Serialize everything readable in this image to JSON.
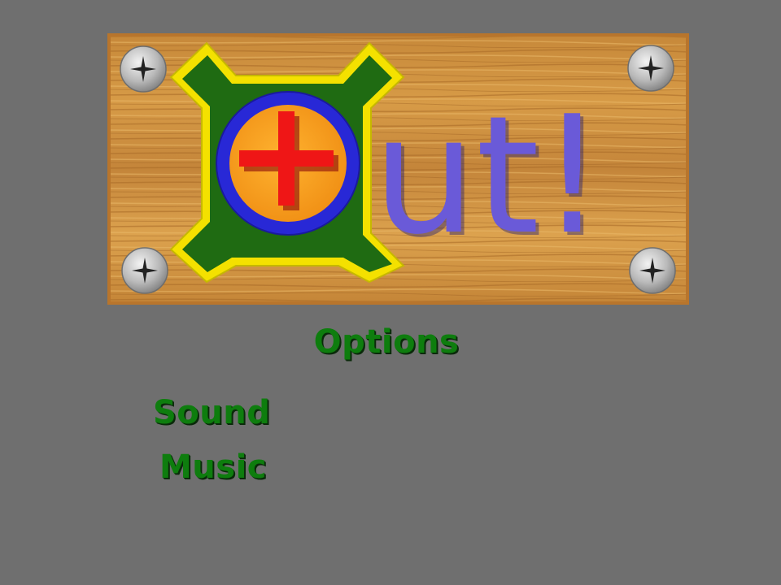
{
  "logo": {
    "text": "ut!",
    "text_color": "#6a5ad8",
    "board_color": "#c98a3c",
    "emblem_colors": {
      "frame_outer": "#f4e100",
      "frame_inner": "#1f6b12",
      "ring": "#2828d6",
      "disc": "#f5a623",
      "cross": "#ef1616"
    }
  },
  "menu": {
    "title": "Options",
    "items": [
      {
        "label": "Sound"
      },
      {
        "label": "Music"
      }
    ],
    "text_color": "#0e7d0e"
  },
  "background_color": "#6f6f6f"
}
